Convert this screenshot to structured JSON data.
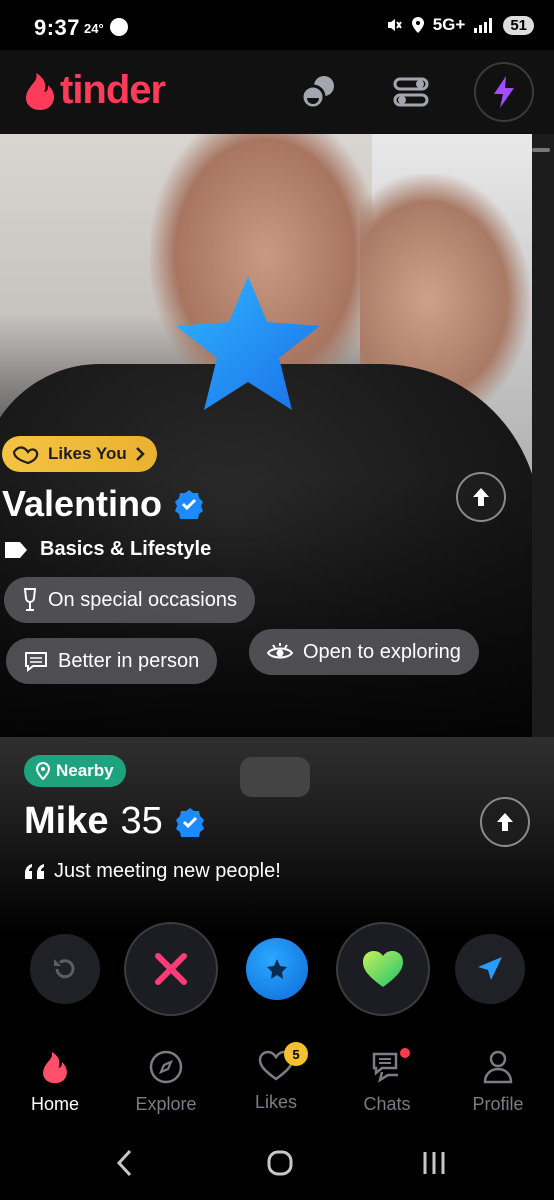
{
  "status_bar": {
    "time": "9:37",
    "temperature": "24°",
    "network": "5G+",
    "battery": "51"
  },
  "header": {
    "brand": "tinder",
    "brand_color": "#fe3c5a",
    "icons": [
      "double-date-icon",
      "filter-icon",
      "boost-icon"
    ]
  },
  "current_card": {
    "badge": "Likes You",
    "name": "Valentino",
    "verified": true,
    "section_label": "Basics & Lifestyle",
    "chips": [
      {
        "icon": "drink-icon",
        "label": "On special occasions"
      },
      {
        "icon": "chat-bubble-icon",
        "label": "Better in person"
      },
      {
        "icon": "eye-icon",
        "label": "Open to exploring"
      }
    ]
  },
  "next_card": {
    "badge": "Nearby",
    "name": "Mike",
    "age": "35",
    "verified": true,
    "quote": "Just meeting new people!"
  },
  "actions": {
    "rewind": "rewind-icon",
    "nope": "x-icon",
    "super_like": "star-icon",
    "like": "heart-icon",
    "super_message": "send-icon"
  },
  "bottom_nav": {
    "home": "Home",
    "explore": "Explore",
    "likes": "Likes",
    "likes_badge": "5",
    "chats": "Chats",
    "profile": "Profile"
  }
}
